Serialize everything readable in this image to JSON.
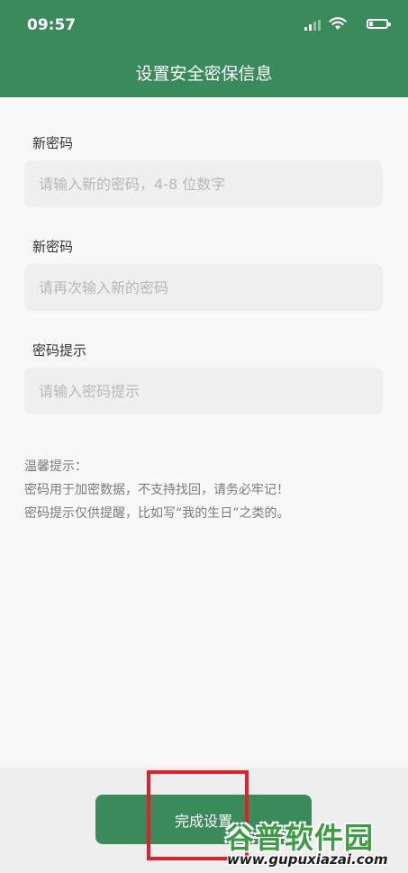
{
  "status_bar": {
    "time": "09:57",
    "icons": [
      "cellular-signal-icon",
      "wifi-icon",
      "battery-icon"
    ]
  },
  "header": {
    "title": "设置安全密保信息"
  },
  "form": {
    "fields": [
      {
        "label": "新密码",
        "value": "",
        "placeholder": "请输入新的密码，4-8 位数字"
      },
      {
        "label": "新密码",
        "value": "",
        "placeholder": "请再次输入新的密码"
      },
      {
        "label": "密码提示",
        "value": "",
        "placeholder": "请输入密码提示"
      }
    ]
  },
  "tips": {
    "title": "温馨提示：",
    "lines": [
      "密码用于加密数据，不支持找回，请务必牢记！",
      "密码提示仅供提醒，比如写“我的生日”之类的。"
    ]
  },
  "footer": {
    "button_label": "完成设置"
  },
  "watermark": {
    "brand": "谷普软件园",
    "url": "www.gupuxiazai.com"
  },
  "colors": {
    "header_bg": "#3a8a5c",
    "button_bg": "#3a8a5c",
    "annotation_box": "#e3202a",
    "watermark_green": "#3b9d41"
  }
}
